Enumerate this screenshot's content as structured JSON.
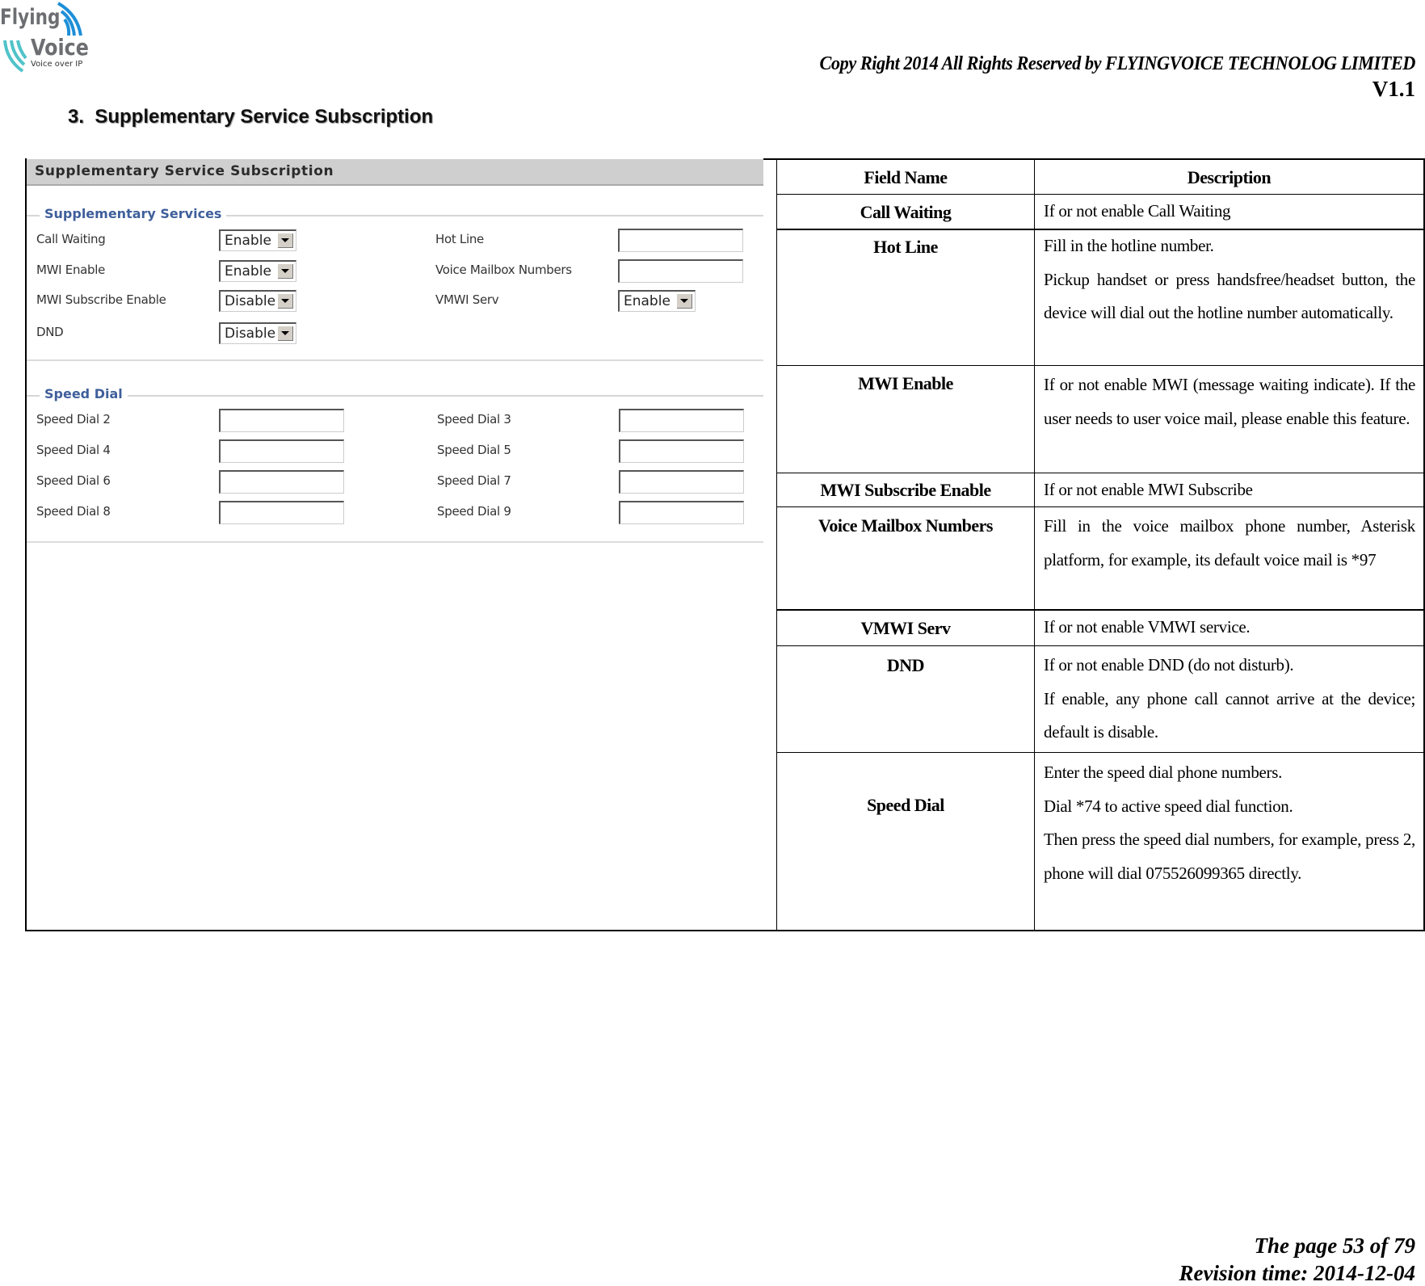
{
  "header": {
    "logo": {
      "line1": "Flying",
      "line2": "Voice",
      "tagline": "Voice over IP",
      "icon": "wifi-waves-icon",
      "colors": {
        "text": "#6d6e71",
        "wave_blue": "#1e8fd8",
        "wave_teal": "#4fc3c9"
      }
    },
    "copyright": "Copy Right 2014 All Rights Reserved by FLYINGVOICE TECHNOLOG LIMITED",
    "version": "V1.1"
  },
  "section": {
    "heading": "3.  Supplementary Service Subscription"
  },
  "screenshot": {
    "title": "Supplementary Service Subscription",
    "supplementary_services": {
      "legend": "Supplementary Services",
      "left_fields": [
        {
          "label": "Call Waiting",
          "type": "select",
          "value": "Enable"
        },
        {
          "label": "MWI Enable",
          "type": "select",
          "value": "Enable"
        },
        {
          "label": "MWI Subscribe Enable",
          "type": "select",
          "value": "Disable"
        },
        {
          "label": "DND",
          "type": "select",
          "value": "Disable"
        }
      ],
      "right_fields": [
        {
          "label": "Hot Line",
          "type": "text",
          "value": ""
        },
        {
          "label": "Voice Mailbox Numbers",
          "type": "text",
          "value": ""
        },
        {
          "label": "VMWI Serv",
          "type": "select",
          "value": "Enable"
        }
      ]
    },
    "speed_dial": {
      "legend": "Speed Dial",
      "left_fields": [
        {
          "label": "Speed Dial 2",
          "value": ""
        },
        {
          "label": "Speed Dial 4",
          "value": ""
        },
        {
          "label": "Speed Dial 6",
          "value": ""
        },
        {
          "label": "Speed Dial 8",
          "value": ""
        }
      ],
      "right_fields": [
        {
          "label": "Speed Dial 3",
          "value": ""
        },
        {
          "label": "Speed Dial 5",
          "value": ""
        },
        {
          "label": "Speed Dial 7",
          "value": ""
        },
        {
          "label": "Speed Dial 9",
          "value": ""
        }
      ]
    },
    "colors": {
      "title_bar": "#cfcfcf",
      "legend_text": "#3f5f9b"
    }
  },
  "table": {
    "headers": [
      "Field Name",
      "Description"
    ],
    "rows": [
      {
        "field": "Call Waiting",
        "description": [
          "If or not enable Call Waiting"
        ]
      },
      {
        "field": "Hot Line",
        "description": [
          "Fill in the hotline number.",
          "Pickup handset or press handsfree/headset button, the device will dial out the hotline number automatically."
        ]
      },
      {
        "field": "MWI Enable",
        "description": [
          "If or not enable MWI (message waiting indicate). If the user needs to user voice mail, please enable this feature."
        ]
      },
      {
        "field": "MWI Subscribe Enable",
        "description": [
          "If or not enable MWI Subscribe"
        ]
      },
      {
        "field": "Voice Mailbox Numbers",
        "description": [
          "Fill in the voice mailbox phone number, Asterisk platform, for example, its default voice mail is *97"
        ]
      },
      {
        "field": "VMWI Serv",
        "description": [
          "If or not enable VMWI service."
        ]
      },
      {
        "field": "DND",
        "description": [
          "If or not enable DND (do not disturb).",
          "If enable, any phone call cannot arrive at the device; default is disable."
        ]
      },
      {
        "field": "Speed Dial",
        "description": [
          "Enter the speed dial phone numbers.",
          "Dial *74 to active speed dial function.",
          "Then press the speed dial numbers, for example, press 2, phone will dial 075526099365 directly."
        ]
      }
    ]
  },
  "footer": {
    "page": "The page 53 of 79",
    "revision": "Revision time: 2014-12-04"
  }
}
